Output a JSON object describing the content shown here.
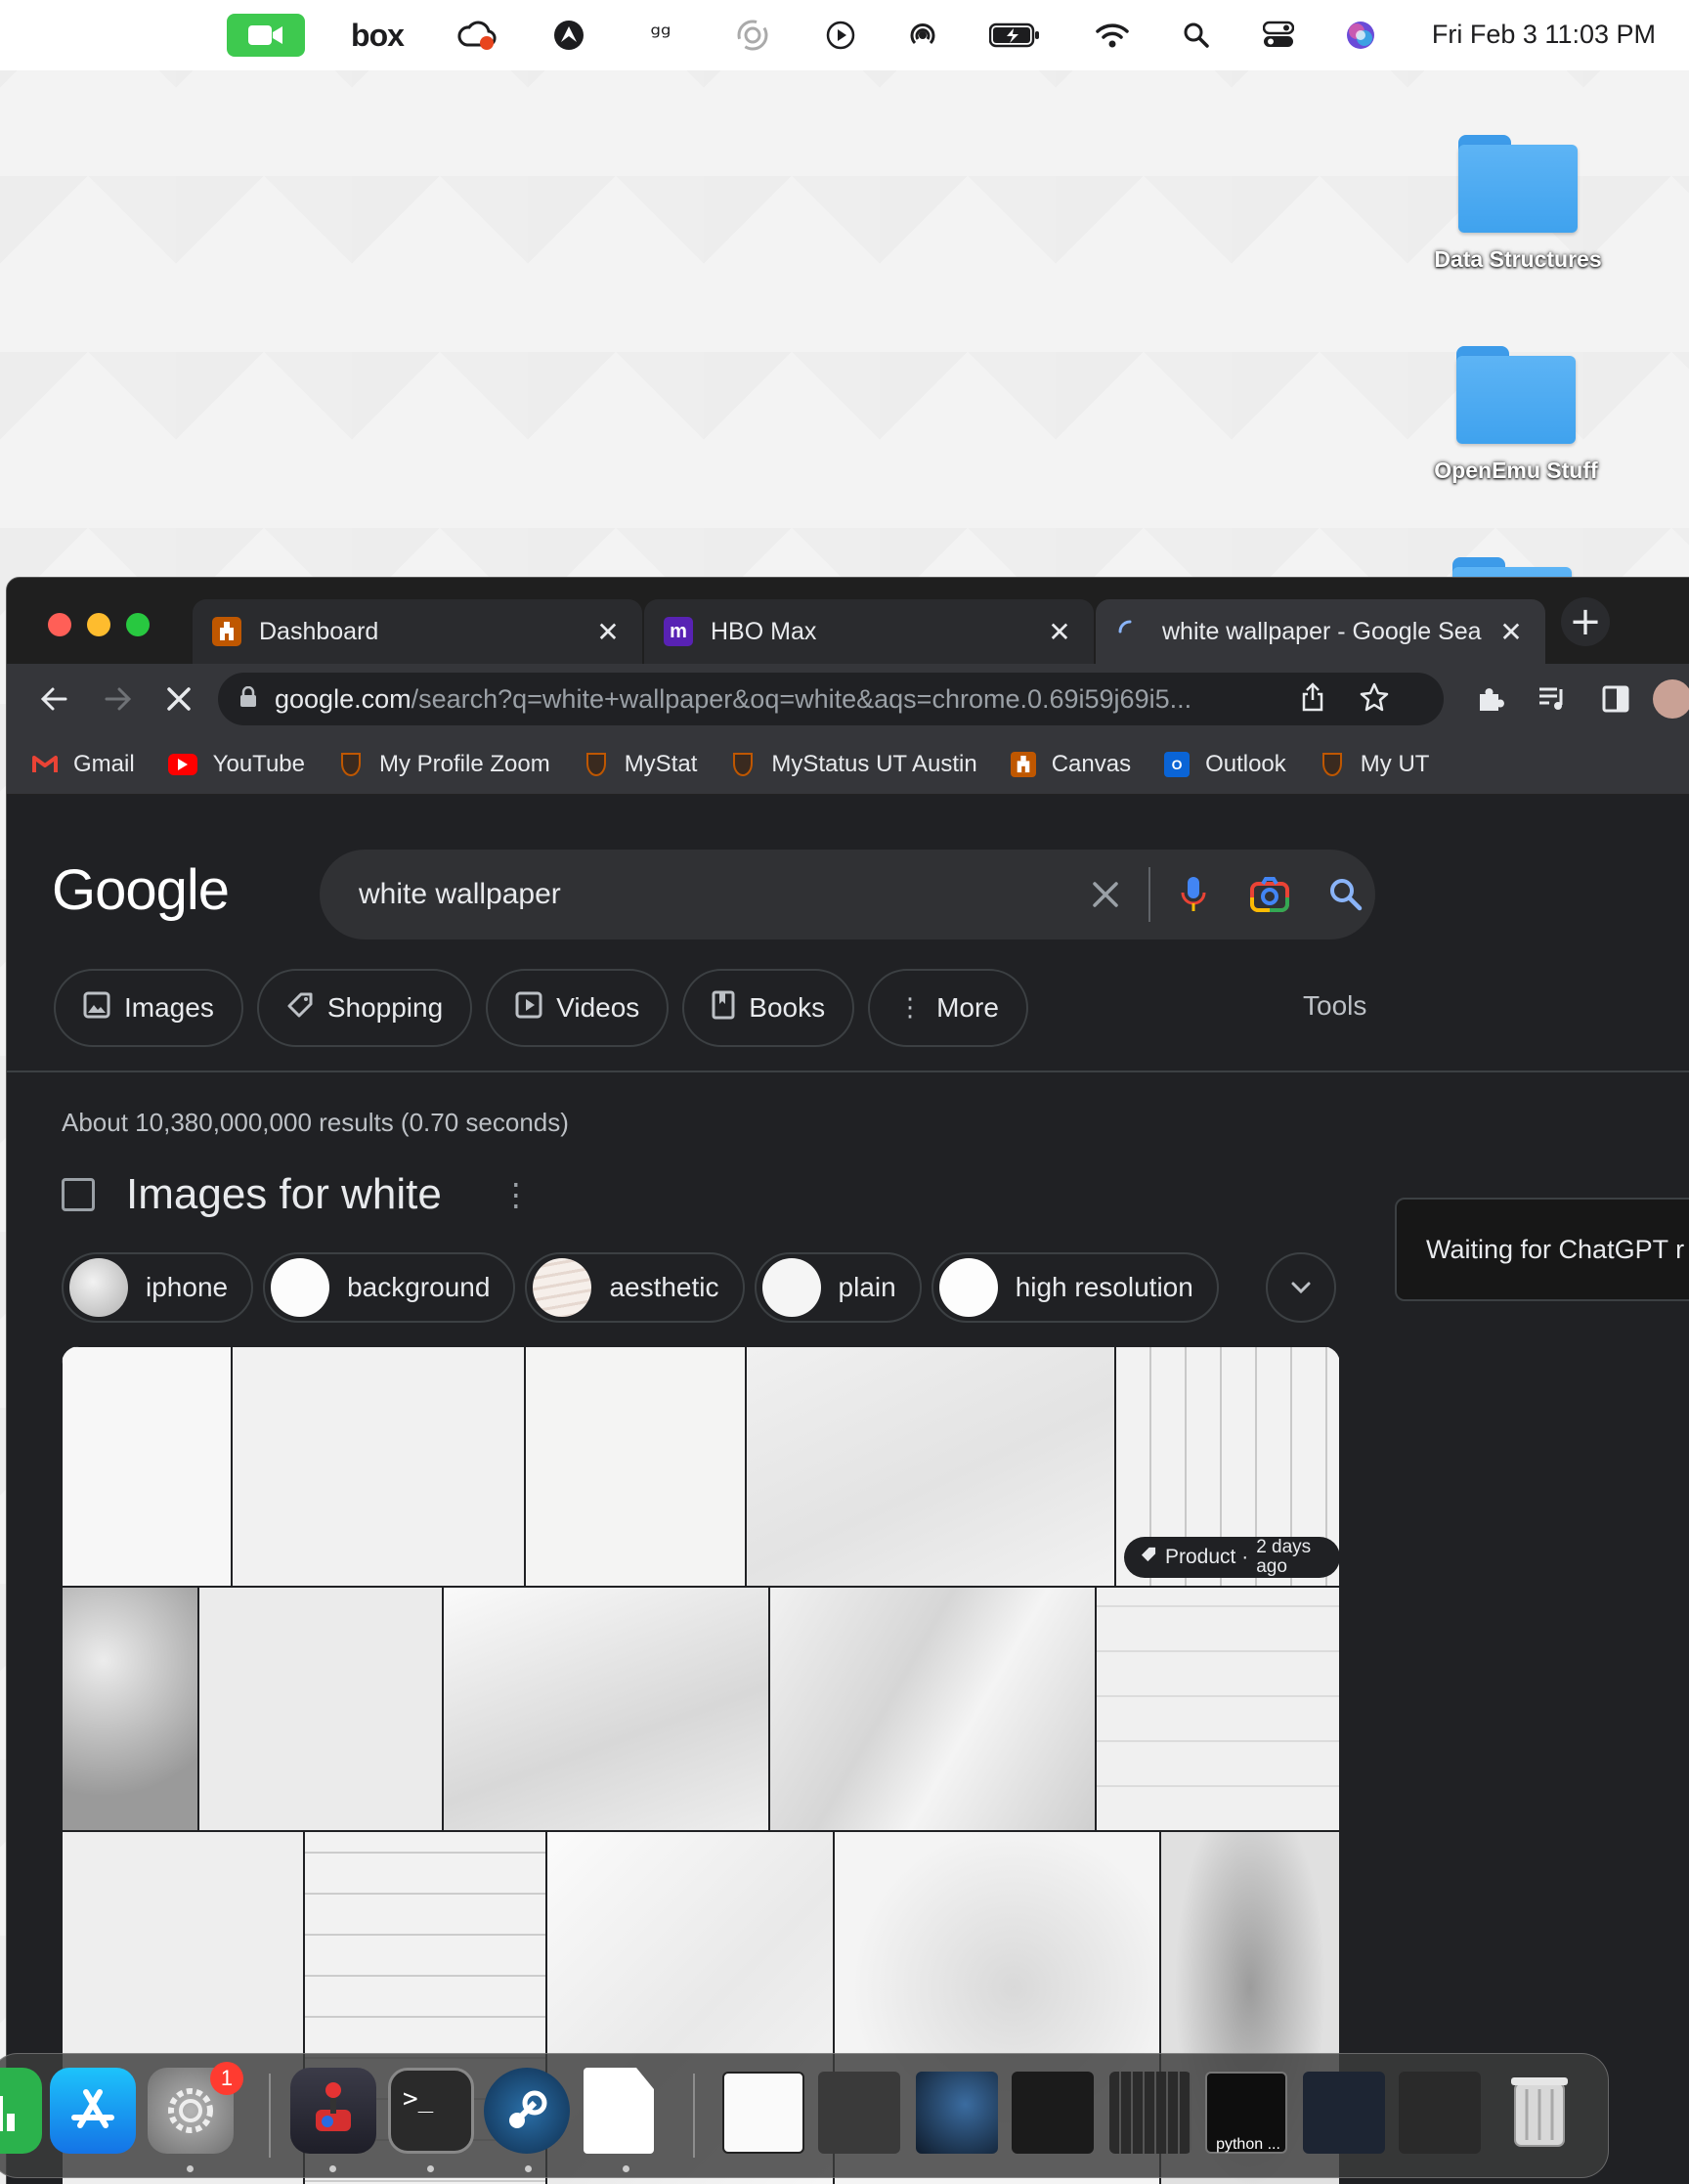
{
  "menubar": {
    "clock": "Fri Feb 3  11:03 PM",
    "icons": [
      "facetime-icon",
      "box-icon",
      "creative-cloud-icon",
      "vpn-icon",
      "airpods-icon",
      "focus-icon",
      "play-icon",
      "airdrop-icon",
      "battery-icon",
      "wifi-icon",
      "spotlight-icon",
      "control-center-icon",
      "siri-icon"
    ],
    "box_label": "box"
  },
  "desktop": {
    "folders": [
      {
        "label": "Data Structures"
      },
      {
        "label": "OpenEmu Stuff"
      }
    ]
  },
  "browser": {
    "tabs": [
      {
        "title": "Dashboard",
        "close": "✕"
      },
      {
        "title": "HBO Max",
        "favicon": "m",
        "close": "✕"
      },
      {
        "title": "white wallpaper - Google Sea",
        "close": "✕"
      }
    ],
    "new_tab": "+",
    "url_host": "google.com",
    "url_path": "/search?q=white+wallpaper&oq=white&aqs=chrome.0.69i59j69i5...",
    "bookmarks": [
      {
        "label": "Gmail",
        "icon": "gmail-icon"
      },
      {
        "label": "YouTube",
        "icon": "youtube-icon"
      },
      {
        "label": "My Profile Zoom",
        "icon": "ut-shield-icon"
      },
      {
        "label": "MyStat",
        "icon": "ut-shield-icon"
      },
      {
        "label": "MyStatus UT Austin",
        "icon": "ut-shield-icon"
      },
      {
        "label": "Canvas",
        "icon": "ut-tower-icon"
      },
      {
        "label": "Outlook",
        "icon": "outlook-icon"
      },
      {
        "label": "My UT",
        "icon": "ut-shield-icon"
      }
    ]
  },
  "google": {
    "logo": "Google",
    "query": "white wallpaper",
    "filters": [
      {
        "label": "Images",
        "icon": "image-icon"
      },
      {
        "label": "Shopping",
        "icon": "tag-icon"
      },
      {
        "label": "Videos",
        "icon": "video-icon"
      },
      {
        "label": "Books",
        "icon": "book-icon"
      },
      {
        "label": "More",
        "icon": "kebab-icon"
      }
    ],
    "tools": "Tools",
    "stats": "About 10,380,000,000 results (0.70 seconds)",
    "images_header": "Images for white",
    "refinements": [
      "iphone",
      "background",
      "aesthetic",
      "plain",
      "high resolution"
    ],
    "side_panel": "Waiting for ChatGPT r",
    "badge": {
      "label": "Product ·",
      "age": "2 days ago"
    }
  },
  "dock": {
    "python_label": "python ...",
    "settings_badge": "1"
  }
}
